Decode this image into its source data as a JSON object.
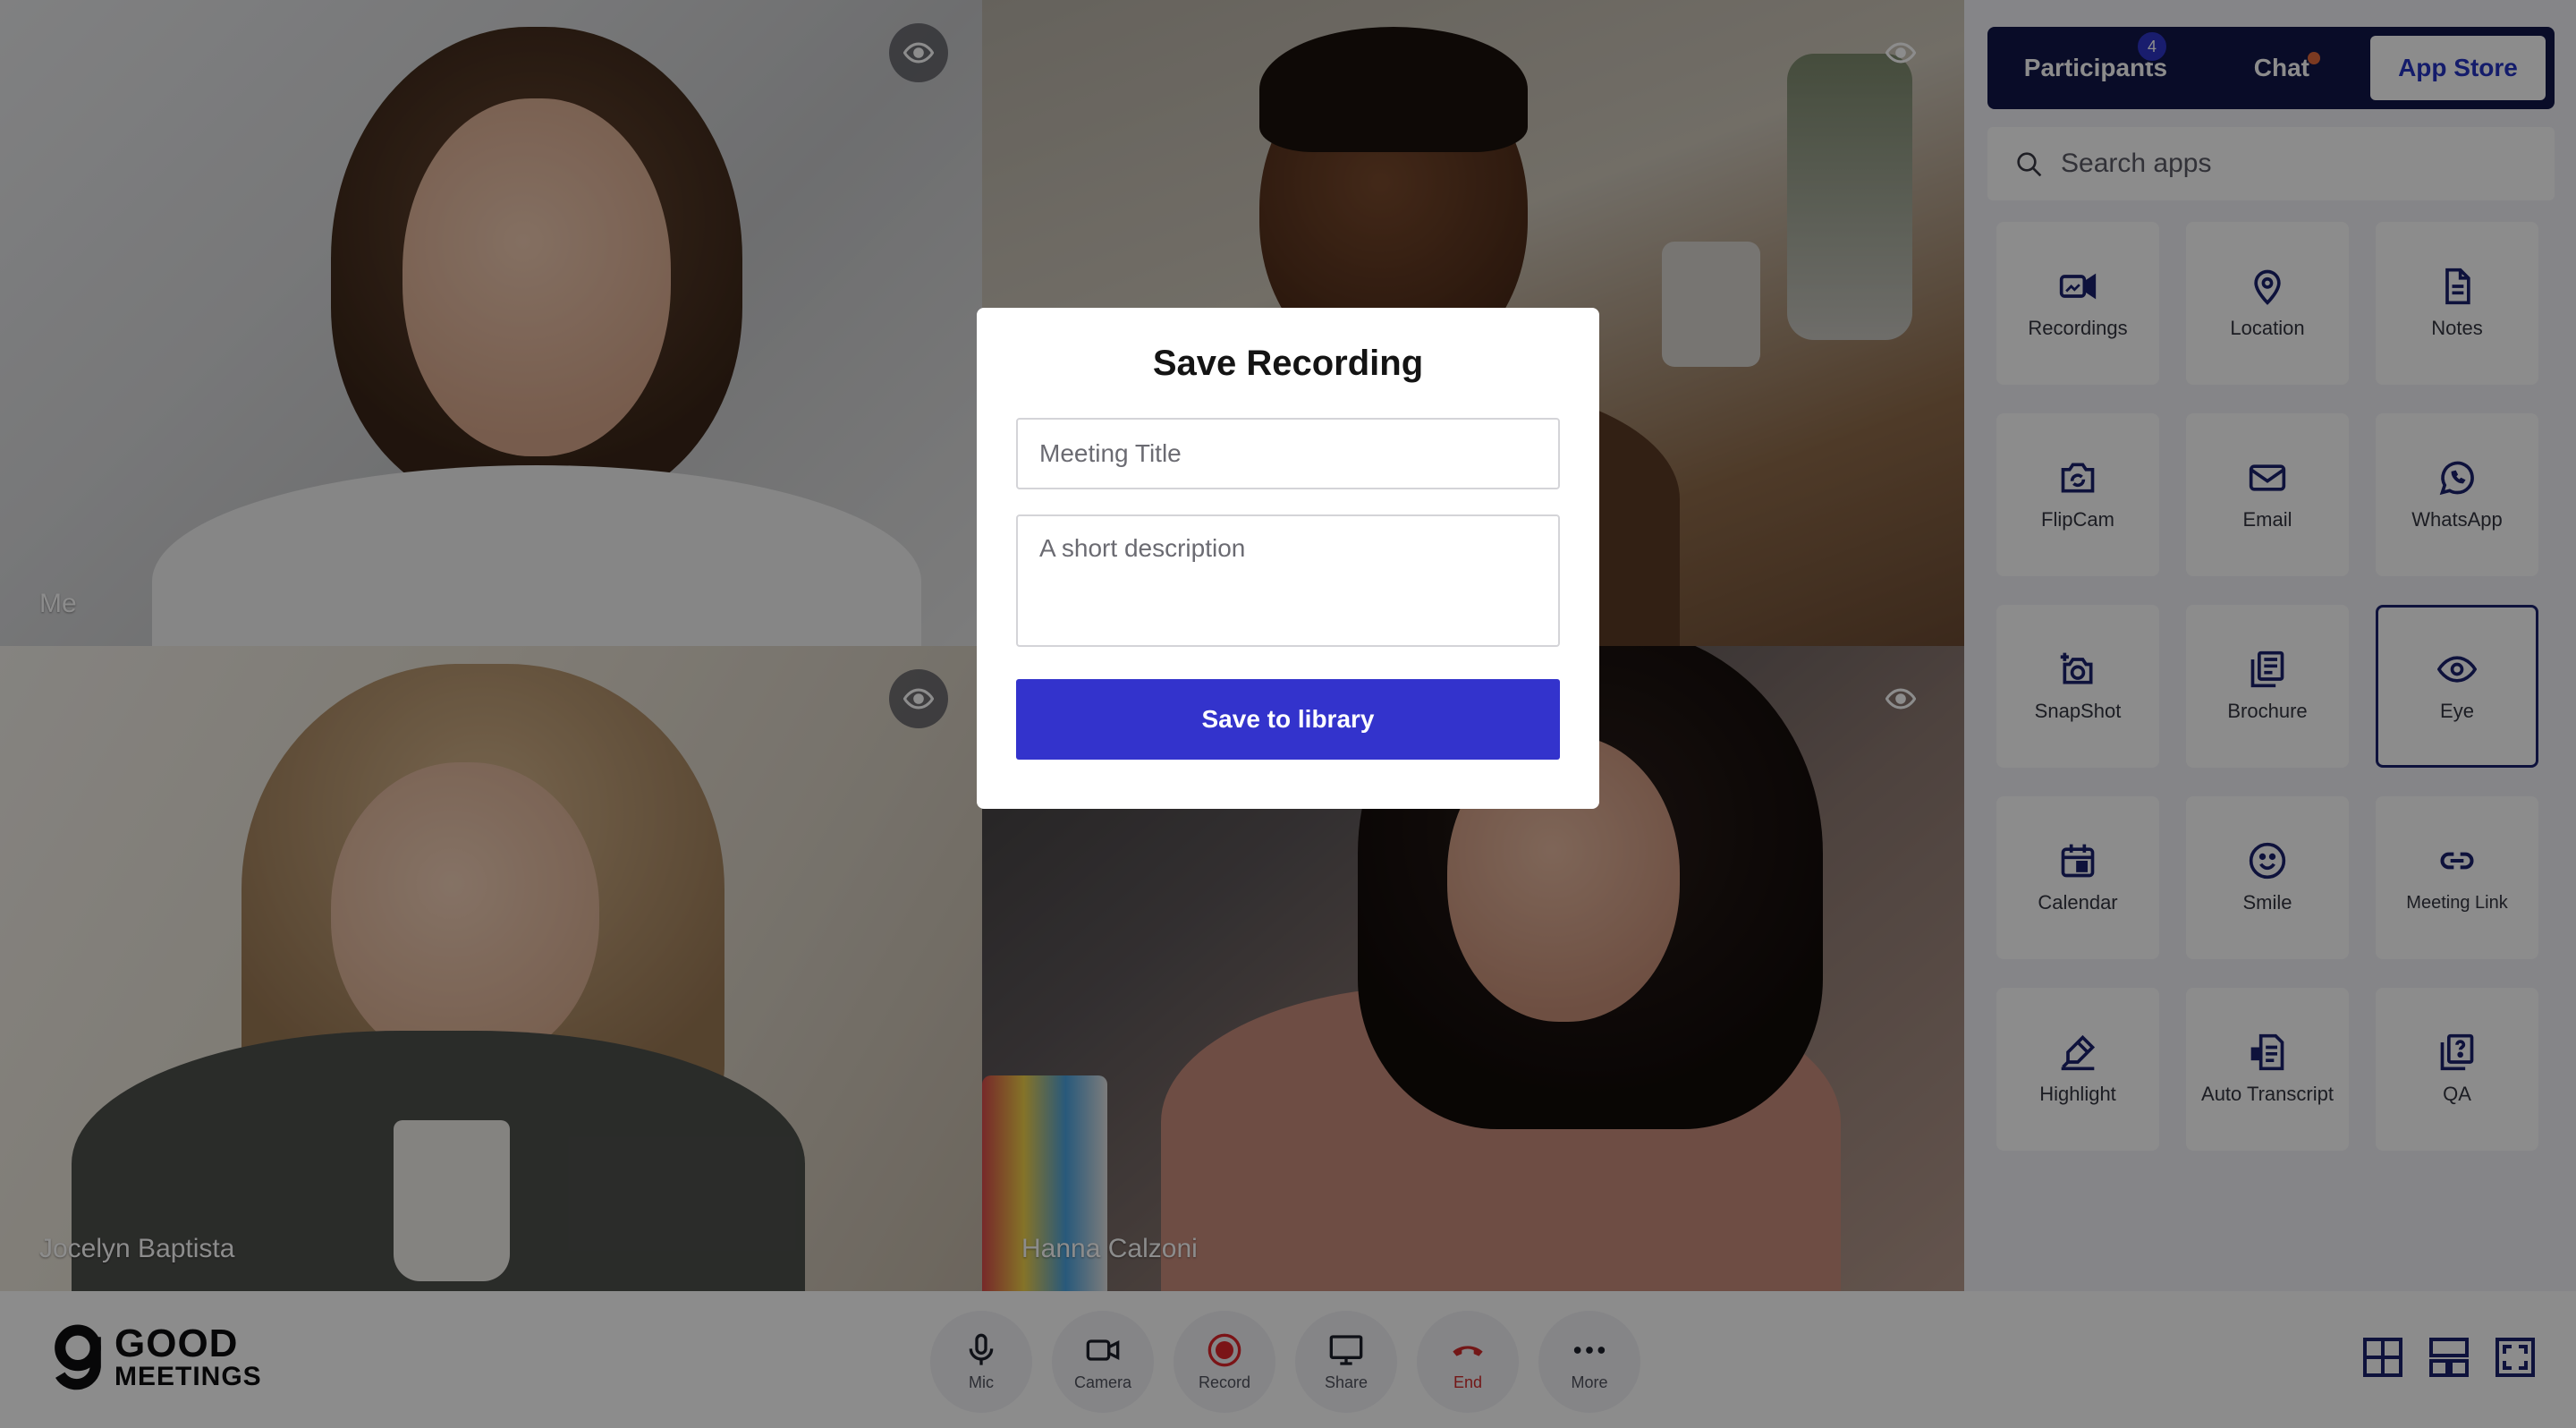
{
  "tiles": [
    {
      "label": "Me"
    },
    {
      "label": ""
    },
    {
      "label": "Jocelyn Baptista"
    },
    {
      "label": "Hanna Calzoni"
    }
  ],
  "sidebar": {
    "tabs": {
      "participants": "Participants",
      "participants_count": "4",
      "chat": "Chat",
      "app_store": "App Store"
    },
    "search_placeholder": "Search apps",
    "apps": [
      {
        "label": "Recordings",
        "icon": "video-icon"
      },
      {
        "label": "Location",
        "icon": "map-pin-icon"
      },
      {
        "label": "Notes",
        "icon": "document-icon"
      },
      {
        "label": "FlipCam",
        "icon": "flip-camera-icon"
      },
      {
        "label": "Email",
        "icon": "mail-icon"
      },
      {
        "label": "WhatsApp",
        "icon": "whatsapp-icon"
      },
      {
        "label": "SnapShot",
        "icon": "snapshot-camera-icon"
      },
      {
        "label": "Brochure",
        "icon": "brochure-icon"
      },
      {
        "label": "Eye",
        "icon": "eye-icon",
        "selected": true
      },
      {
        "label": "Calendar",
        "icon": "calendar-icon"
      },
      {
        "label": "Smile",
        "icon": "smile-icon"
      },
      {
        "label": "Meeting Link",
        "icon": "link-icon"
      },
      {
        "label": "Highlight",
        "icon": "highlighter-icon"
      },
      {
        "label": "Auto Transcript",
        "icon": "transcript-icon"
      },
      {
        "label": "QA",
        "icon": "question-icon"
      }
    ]
  },
  "logo": {
    "line1": "GOOD",
    "line2": "MEETINGS"
  },
  "controls": {
    "mic": "Mic",
    "camera": "Camera",
    "record": "Record",
    "share": "Share",
    "end": "End",
    "more": "More"
  },
  "modal": {
    "title": "Save Recording",
    "title_placeholder": "Meeting Title",
    "description_placeholder": "A short description",
    "save_label": "Save to library"
  },
  "colors": {
    "accent": "#3333cc",
    "tab_bar": "#12164a",
    "end_call": "#d22b2b",
    "record": "#e0262b"
  }
}
